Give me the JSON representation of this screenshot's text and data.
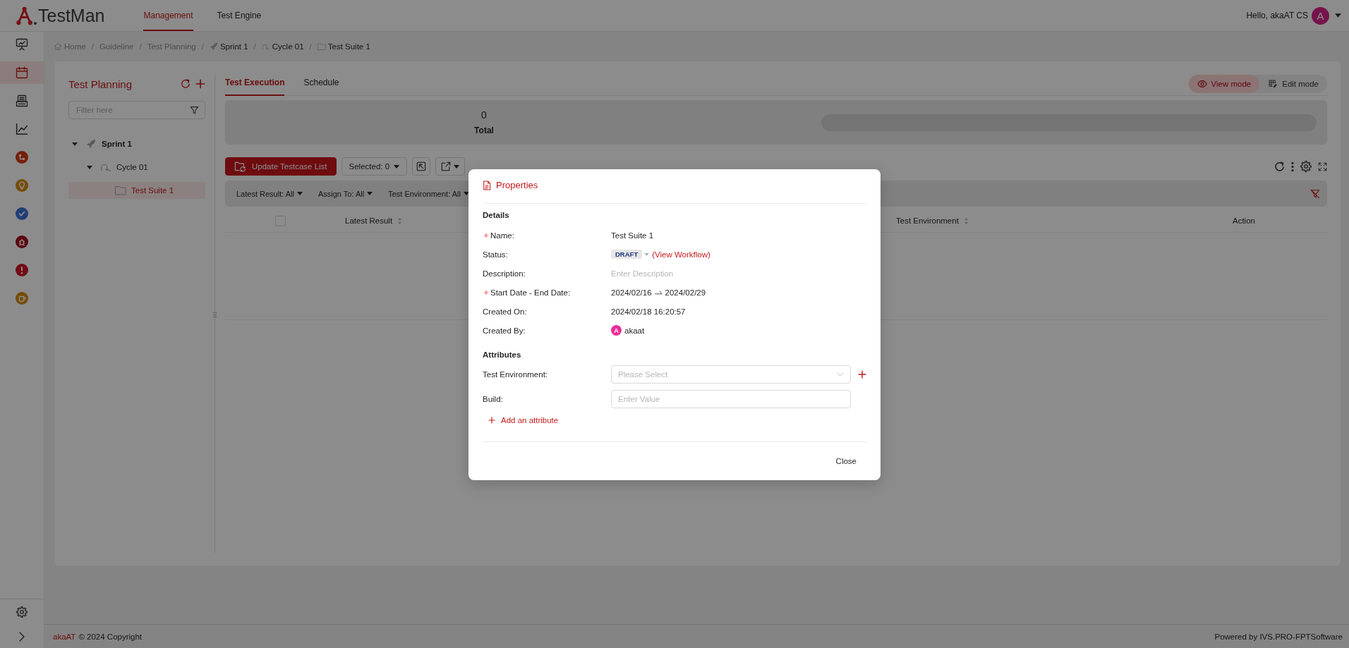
{
  "header": {
    "logo": "TestMan",
    "nav": [
      {
        "label": "Management",
        "selected": true
      },
      {
        "label": "Test Engine",
        "selected": false
      }
    ],
    "greeting": "Hello, akaAT CS",
    "avatar": "A"
  },
  "sidebar": {
    "items": [
      {
        "kind": "board",
        "selected": false
      },
      {
        "kind": "calendar",
        "selected": true
      },
      {
        "kind": "printer",
        "selected": false
      },
      {
        "kind": "chart",
        "selected": false
      },
      {
        "kind": "branch",
        "selected": false
      },
      {
        "kind": "bulb",
        "selected": false
      },
      {
        "kind": "check",
        "selected": false
      },
      {
        "kind": "bug",
        "selected": false
      },
      {
        "kind": "alert",
        "selected": false
      },
      {
        "kind": "cup",
        "selected": false
      }
    ]
  },
  "breadcrumb": {
    "separator": "/",
    "items": [
      {
        "kind": "home",
        "label": "Home"
      },
      {
        "kind": "plain",
        "label": "Guideline"
      },
      {
        "kind": "plain",
        "label": "Test Planning"
      },
      {
        "kind": "sprint",
        "label": "Sprint 1"
      },
      {
        "kind": "cycle",
        "label": "Cycle 01"
      },
      {
        "kind": "suite",
        "label": "Test Suite 1"
      }
    ]
  },
  "planning_panel": {
    "title": "Test Planning",
    "filter": {
      "placeholder": "Filter here"
    },
    "tree": [
      {
        "label": "Sprint 1",
        "kind": "sprint",
        "expanded": true,
        "selected": false,
        "children": [
          {
            "label": "Cycle 01",
            "kind": "cycle",
            "expanded": true,
            "selected": false,
            "children": [
              {
                "label": "Test Suite 1",
                "kind": "suite",
                "selected": true
              }
            ]
          }
        ]
      }
    ]
  },
  "execution_panel": {
    "tabs": [
      {
        "label": "Test Execution",
        "selected": true
      },
      {
        "label": "Schedule",
        "selected": false
      }
    ],
    "modes": [
      {
        "label": "View mode",
        "kind": "view",
        "selected": true
      },
      {
        "label": "Edit mode",
        "kind": "edit",
        "selected": false
      }
    ],
    "summary": {
      "count": "0",
      "label": "Total"
    },
    "toolbar": {
      "update_button": "Update Testcase List",
      "selection_button": "Selected: 0"
    },
    "filters": [
      "Latest Result: All",
      "Assign To: All",
      "Test Environment: All"
    ],
    "table": {
      "select_all": {
        "checked": false
      },
      "columns": [
        {
          "label": "Latest Result",
          "sortable": true
        },
        {
          "label": "Test Environment",
          "sortable": true
        },
        {
          "label": "Action",
          "sortable": false
        }
      ]
    }
  },
  "dialog": {
    "title": "Properties",
    "sections": [
      {
        "title": "Details",
        "fields": [
          {
            "label": "Name:",
            "kind": "text",
            "required": true,
            "value": "Test Suite 1"
          },
          {
            "label": "Status:",
            "kind": "status",
            "required": false,
            "value": "DRAFT",
            "link": "(View Workflow)"
          },
          {
            "label": "Description:",
            "kind": "textarea",
            "required": false,
            "placeholder": "Enter Description"
          },
          {
            "label": "Start Date - End Date:",
            "kind": "daterange",
            "required": true,
            "start": "2024/02/16",
            "end": "2024/02/29"
          },
          {
            "label": "Created On:",
            "kind": "text",
            "required": false,
            "value": "2024/02/18 16:20:57"
          },
          {
            "label": "Created By:",
            "kind": "user",
            "required": false,
            "avatar": "A",
            "value": "akaat"
          }
        ]
      },
      {
        "title": "Attributes",
        "fields": [
          {
            "label": "Test Environment:",
            "kind": "select",
            "required": false,
            "placeholder": "Please Select",
            "addable": true
          },
          {
            "label": "Build:",
            "kind": "input",
            "required": false,
            "placeholder": "Enter Value",
            "addable": false
          }
        ]
      }
    ],
    "add_attribute": "Add an attribute",
    "close": "Close"
  },
  "footer": {
    "brand": "akaAT",
    "copyright": "© 2024 Copyright",
    "powered_by": "Powered by IVS.PRO-FPTSoftware"
  }
}
